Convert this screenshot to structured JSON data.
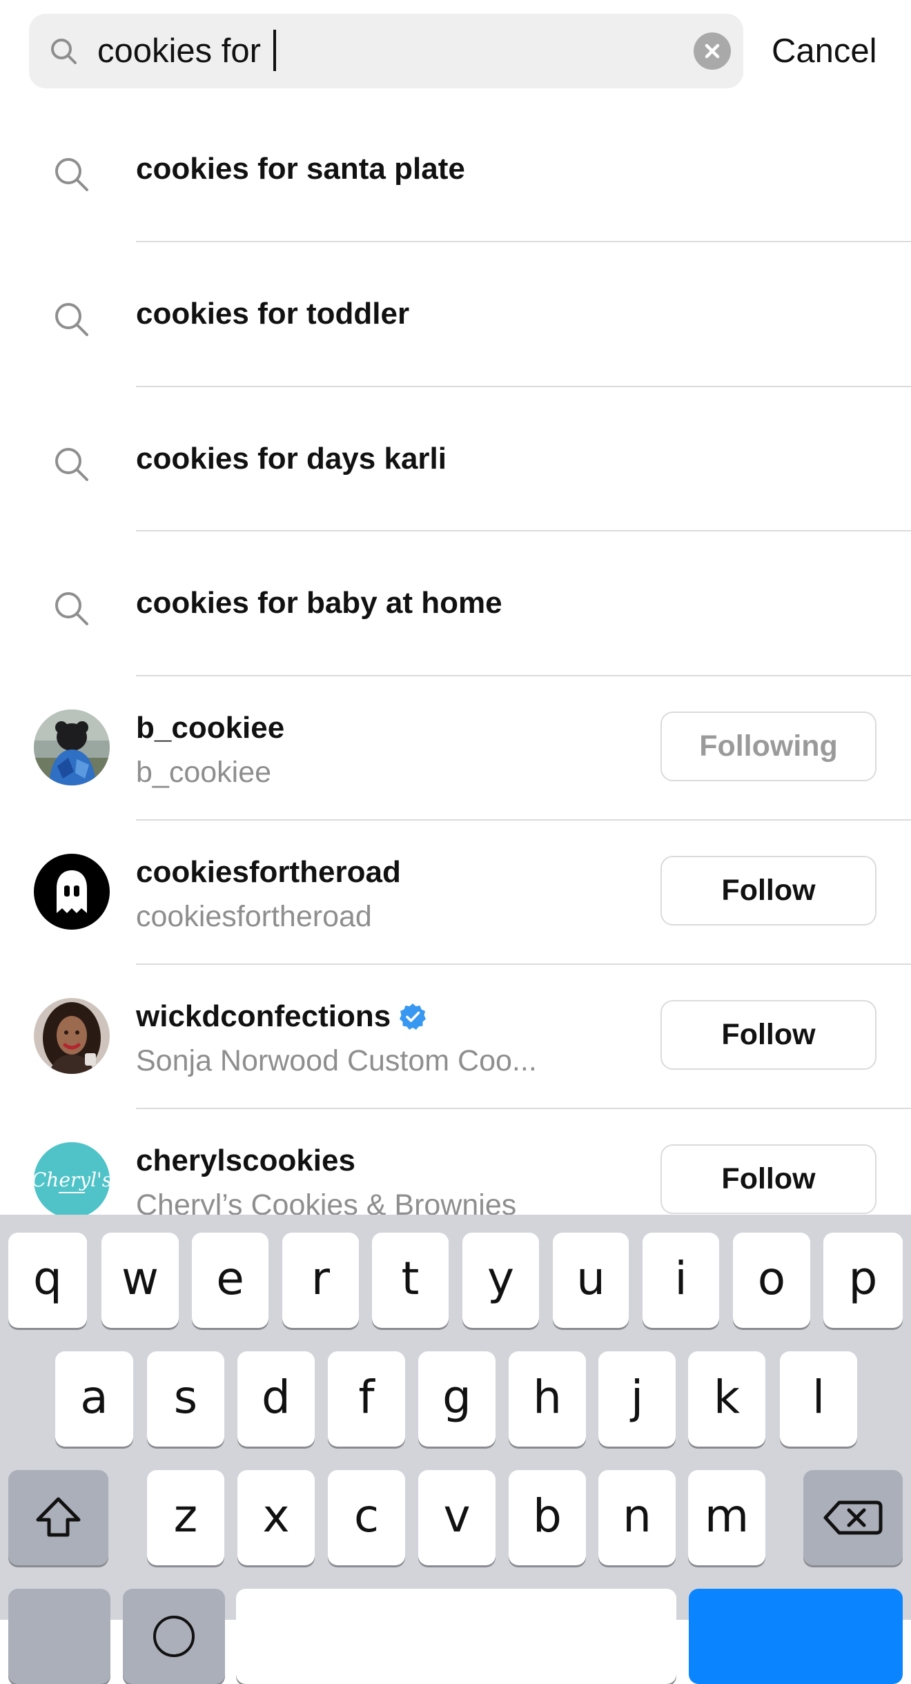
{
  "search": {
    "query": "cookies for ",
    "cancel_label": "Cancel"
  },
  "suggestions": [
    {
      "label": "cookies for santa plate"
    },
    {
      "label": "cookies for toddler"
    },
    {
      "label": "cookies for days karli"
    },
    {
      "label": "cookies for baby at home"
    }
  ],
  "accounts": [
    {
      "username": "b_cookiee",
      "subtitle": "b_cookiee",
      "button": "Following",
      "verified": false
    },
    {
      "username": "cookiesfortheroad",
      "subtitle": "cookiesfortheroad",
      "button": "Follow",
      "verified": false
    },
    {
      "username": "wickdconfections",
      "subtitle": "Sonja Norwood Custom Coo...",
      "button": "Follow",
      "verified": true
    },
    {
      "username": "cherylscookies",
      "subtitle": "Cheryl’s Cookies & Brownies",
      "button": "Follow",
      "verified": false
    }
  ],
  "avatars": {
    "cherylscookies_logo_text": "Cheryl's"
  },
  "keyboard": {
    "row1": [
      "q",
      "w",
      "e",
      "r",
      "t",
      "y",
      "u",
      "i",
      "o",
      "p"
    ],
    "row2": [
      "a",
      "s",
      "d",
      "f",
      "g",
      "h",
      "j",
      "k",
      "l"
    ],
    "row3": [
      "z",
      "x",
      "c",
      "v",
      "b",
      "n",
      "m"
    ]
  },
  "colors": {
    "verified_badge": "#3897f0",
    "keyboard_bg": "#d2d4da",
    "return_key": "#0a84ff"
  }
}
